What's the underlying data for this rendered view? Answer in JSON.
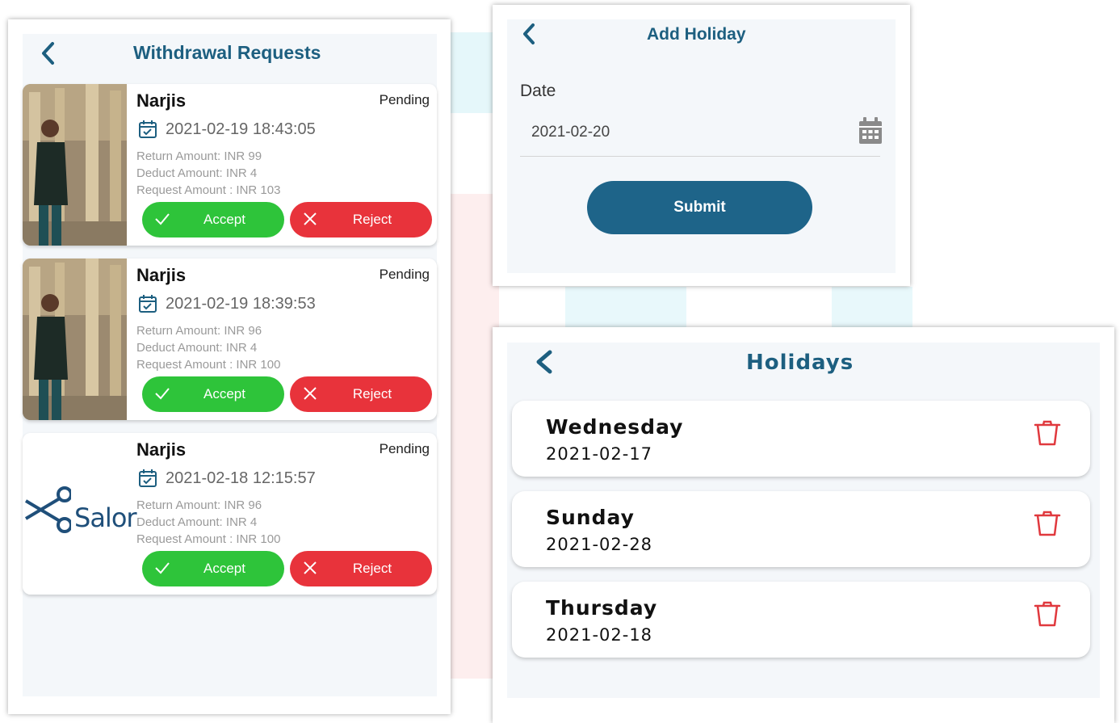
{
  "withdrawal": {
    "title": "Withdrawal Requests",
    "requests": [
      {
        "name": "Narjis",
        "status": "Pending",
        "datetime": "2021-02-19 18:43:05",
        "return_amount": "Return Amount: INR 99",
        "deduct_amount": "Deduct Amount: INR 4",
        "request_amount": "Request Amount : INR 103",
        "accept_label": "Accept",
        "reject_label": "Reject",
        "image": "person-photo"
      },
      {
        "name": "Narjis",
        "status": "Pending",
        "datetime": "2021-02-19 18:39:53",
        "return_amount": "Return Amount: INR 96",
        "deduct_amount": "Deduct Amount: INR 4",
        "request_amount": "Request Amount : INR 100",
        "accept_label": "Accept",
        "reject_label": "Reject",
        "image": "person-photo"
      },
      {
        "name": "Narjis",
        "status": "Pending",
        "datetime": "2021-02-18 12:15:57",
        "return_amount": "Return Amount: INR 96",
        "deduct_amount": "Deduct Amount: INR 4",
        "request_amount": "Request Amount : INR 100",
        "accept_label": "Accept",
        "reject_label": "Reject",
        "image": "salor-logo",
        "logo_text": "Salor"
      }
    ]
  },
  "add_holiday": {
    "title": "Add Holiday",
    "date_label": "Date",
    "date_value": "2021-02-20",
    "submit_label": "Submit"
  },
  "holidays": {
    "title": "Holidays",
    "items": [
      {
        "day": "Wednesday",
        "date": "2021-02-17"
      },
      {
        "day": "Sunday",
        "date": "2021-02-28"
      },
      {
        "day": "Thursday",
        "date": "2021-02-18"
      }
    ]
  },
  "colors": {
    "primary": "#1d5f80",
    "accept": "#2ec43a",
    "reject": "#e8333b",
    "trash": "#e0393e"
  },
  "icons": [
    "back-arrow-icon",
    "calendar-check-icon",
    "checkmark-icon",
    "cross-icon",
    "calendar-icon",
    "trash-icon"
  ]
}
